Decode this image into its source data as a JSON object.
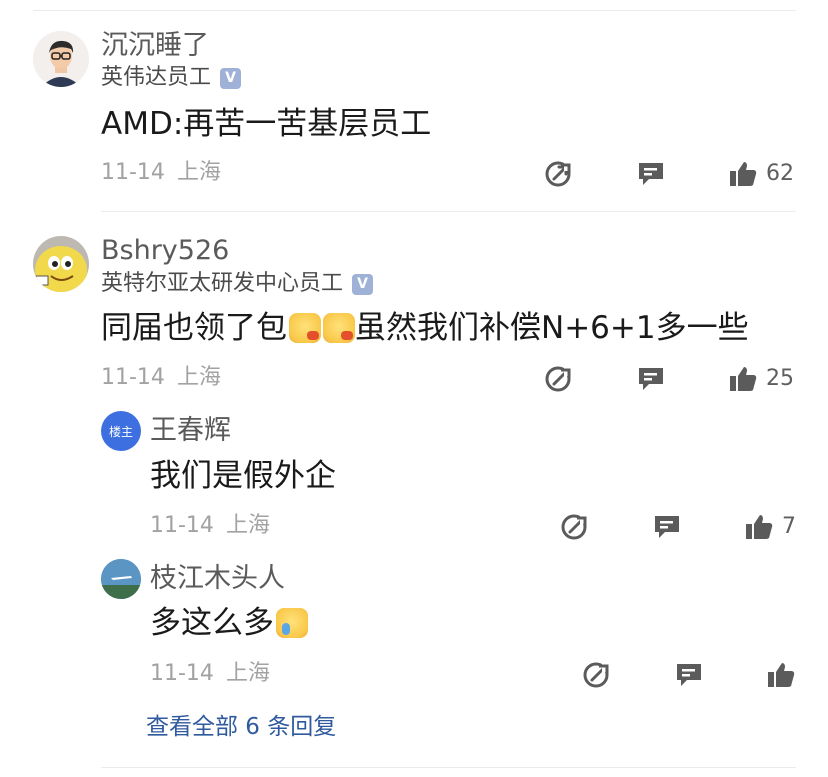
{
  "comments": [
    {
      "name": "沉沉睡了",
      "org": "英伟达员工",
      "badge": "V",
      "content": "AMD:再苦一苦基层员工",
      "date": "11-14",
      "location": "上海",
      "likes": "62"
    },
    {
      "name": "Bshry526",
      "org": "英特尔亚太研发中心员工",
      "badge": "V",
      "content_before": "同届也领了包",
      "content_after": "虽然我们补偿N+6+1多一些",
      "date": "11-14",
      "location": "上海",
      "likes": "25",
      "replies": [
        {
          "name": "王春辉",
          "avatar_label": "楼主",
          "content": "我们是假外企",
          "date": "11-14",
          "location": "上海",
          "likes": "7"
        },
        {
          "name": "枝江木头人",
          "content": "多这么多",
          "date": "11-14",
          "location": "上海",
          "likes": ""
        }
      ],
      "view_all": "查看全部 6 条回复"
    }
  ],
  "colors": {
    "divider": "#ebebeb",
    "link": "#2f5a9e",
    "meta": "#a2a2a2",
    "badge": "#9fb1d6",
    "owner_badge": "#3d6fe0"
  },
  "icons": [
    "share-icon",
    "comment-icon",
    "thumbs-up-icon",
    "verified-badge-icon"
  ]
}
